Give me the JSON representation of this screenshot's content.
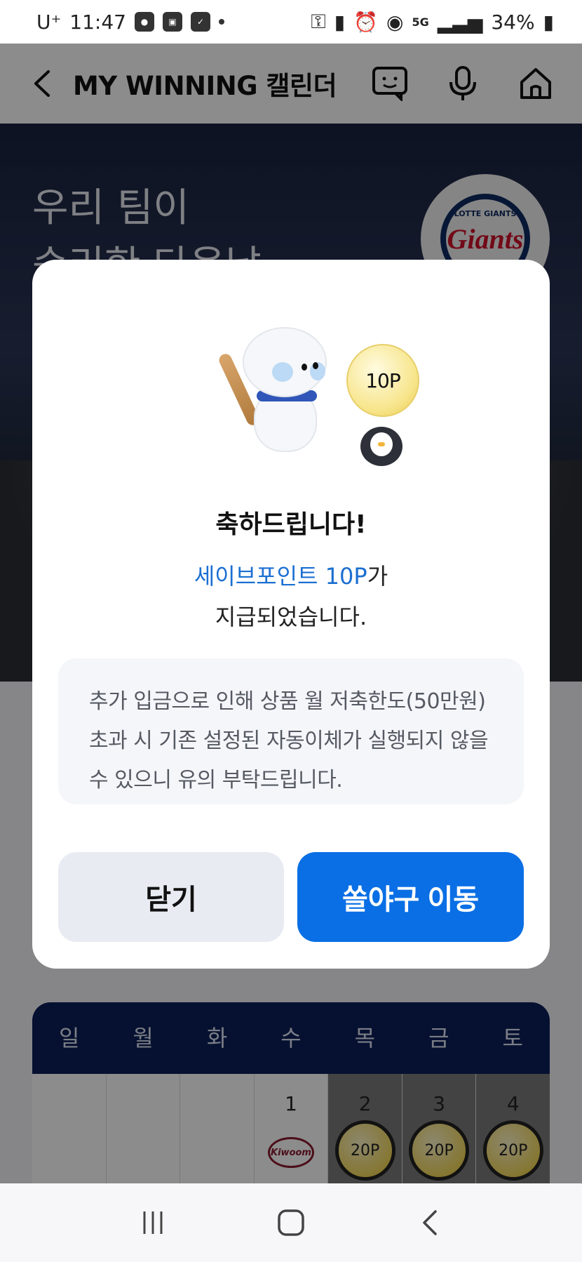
{
  "status": {
    "carrier": "U⁺",
    "time": "11:47",
    "battery": "34%",
    "network": "5G"
  },
  "header": {
    "title": "MY WINNING 캘린더"
  },
  "hero": {
    "line1": "우리 팀이",
    "line2": "승리한 다음날",
    "team_logo_text": "Giants",
    "team_logo_small": "LOTTE GIANTS"
  },
  "calendar": {
    "weekdays": [
      "일",
      "월",
      "화",
      "수",
      "목",
      "금",
      "토"
    ],
    "days": [
      {
        "num": "",
        "coin": ""
      },
      {
        "num": "",
        "coin": ""
      },
      {
        "num": "",
        "coin": ""
      },
      {
        "num": "1",
        "coin": ""
      },
      {
        "num": "2",
        "coin": "20P"
      },
      {
        "num": "3",
        "coin": "20P"
      },
      {
        "num": "4",
        "coin": "20P"
      }
    ],
    "kiwoom_badge": "Kiwoom"
  },
  "modal": {
    "coin_label": "10P",
    "title": "축하드립니다!",
    "highlight": "세이브포인트 10P",
    "line1_suffix": "가",
    "line2": "지급되었습니다.",
    "notice": "추가 입금으로 인해 상품 월 저축한도(50만원)초과 시 기존 설정된 자동이체가 실행되지 않을 수 있으니 유의 부탁드립니다.",
    "close_label": "닫기",
    "go_label": "쏠야구 이동"
  },
  "colors": {
    "primary": "#0a6fe5",
    "highlight": "#1b6fd1",
    "calendar_header": "#0c1f5a"
  }
}
